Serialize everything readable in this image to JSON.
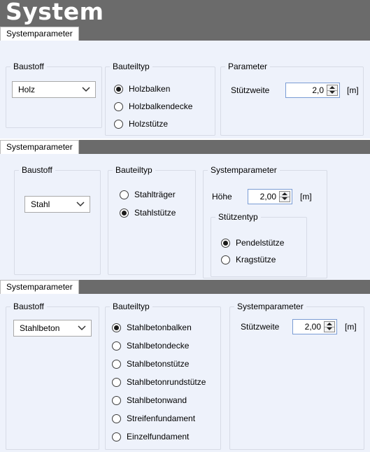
{
  "app": {
    "title": "System"
  },
  "section1": {
    "tab": "Systemparameter",
    "baustoff": {
      "legend": "Baustoff",
      "value": "Holz"
    },
    "bauteiltyp": {
      "legend": "Bauteiltyp",
      "options": [
        {
          "label": "Holzbalken",
          "checked": true
        },
        {
          "label": "Holzbalkendecke",
          "checked": false
        },
        {
          "label": "Holzstütze",
          "checked": false
        }
      ]
    },
    "parameter": {
      "legend": "Parameter",
      "label": "Stützweite",
      "value": "2,0",
      "unit": "[m]"
    }
  },
  "section2": {
    "tab": "Systemparameter",
    "baustoff": {
      "legend": "Baustoff",
      "value": "Stahl"
    },
    "bauteiltyp": {
      "legend": "Bauteiltyp",
      "options": [
        {
          "label": "Stahlträger",
          "checked": false
        },
        {
          "label": "Stahlstütze",
          "checked": true
        }
      ]
    },
    "systemparameter": {
      "legend": "Systemparameter",
      "label": "Höhe",
      "value": "2,00",
      "unit": "[m]",
      "stuetzentyp": {
        "legend": "Stützentyp",
        "options": [
          {
            "label": "Pendelstütze",
            "checked": true
          },
          {
            "label": "Kragstütze",
            "checked": false
          }
        ]
      }
    }
  },
  "section3": {
    "tab": "Systemparameter",
    "baustoff": {
      "legend": "Baustoff",
      "value": "Stahlbeton"
    },
    "bauteiltyp": {
      "legend": "Bauteiltyp",
      "options": [
        {
          "label": "Stahlbetonbalken",
          "checked": true
        },
        {
          "label": "Stahlbetondecke",
          "checked": false
        },
        {
          "label": "Stahlbetonstütze",
          "checked": false
        },
        {
          "label": "Stahlbetonrundstütze",
          "checked": false
        },
        {
          "label": "Stahlbetonwand",
          "checked": false
        },
        {
          "label": "Streifenfundament",
          "checked": false
        },
        {
          "label": "Einzelfundament",
          "checked": false
        }
      ]
    },
    "systemparameter": {
      "legend": "Systemparameter",
      "label": "Stützweite",
      "value": "2,00",
      "unit": "[m]"
    }
  }
}
